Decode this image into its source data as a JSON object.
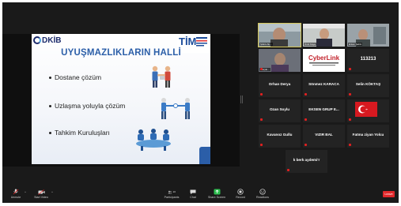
{
  "slide": {
    "logo_left": "DKİB",
    "logo_right": "TİM",
    "title": "UYUŞMAZLIKLARIN HALLİ",
    "bullets": [
      "Dostane çözüm",
      "Uzlaşma yoluyla çözüm",
      "Tahkim Kuruluşları"
    ]
  },
  "participants": [
    {
      "name": "",
      "type": "video",
      "video_label": "Şükrü Ak..."
    },
    {
      "name": "",
      "type": "video",
      "video_label": "Ümit Kaya"
    },
    {
      "name": "",
      "type": "video",
      "video_label": "Erkan Şahin"
    },
    {
      "name": "",
      "type": "video",
      "video_label": "Selçuk..."
    },
    {
      "name": "",
      "type": "logo",
      "logo_text": "CyberLink"
    },
    {
      "name": "113213",
      "type": "text"
    },
    {
      "name": "Orhan Derya",
      "type": "text"
    },
    {
      "name": "Sönmez KARACA",
      "type": "text"
    },
    {
      "name": "Selin KÖKTAŞ",
      "type": "text"
    },
    {
      "name": "Ozan Soylu",
      "type": "text"
    },
    {
      "name": "EKSEN GRUP E...",
      "type": "text"
    },
    {
      "name": "",
      "type": "flag"
    },
    {
      "name": "Kavanoz Gullu",
      "type": "text"
    },
    {
      "name": "VIZIR BAL",
      "type": "text"
    },
    {
      "name": "Fatma ziyan Yolcu",
      "type": "text"
    },
    {
      "name": "k berk aydemi'r",
      "type": "text"
    }
  ],
  "toolbar": {
    "unmute": "Unmute",
    "start_video": "Start Video",
    "participants": "Participants",
    "participants_count": "20",
    "chat": "Chat",
    "share_screen": "Share Screen",
    "record": "Record",
    "reactions": "Reactions",
    "end": "Leave"
  },
  "colors": {
    "accent_green": "#2dbe4f",
    "end_red": "#e0282b",
    "title_blue": "#2b5ea8"
  }
}
